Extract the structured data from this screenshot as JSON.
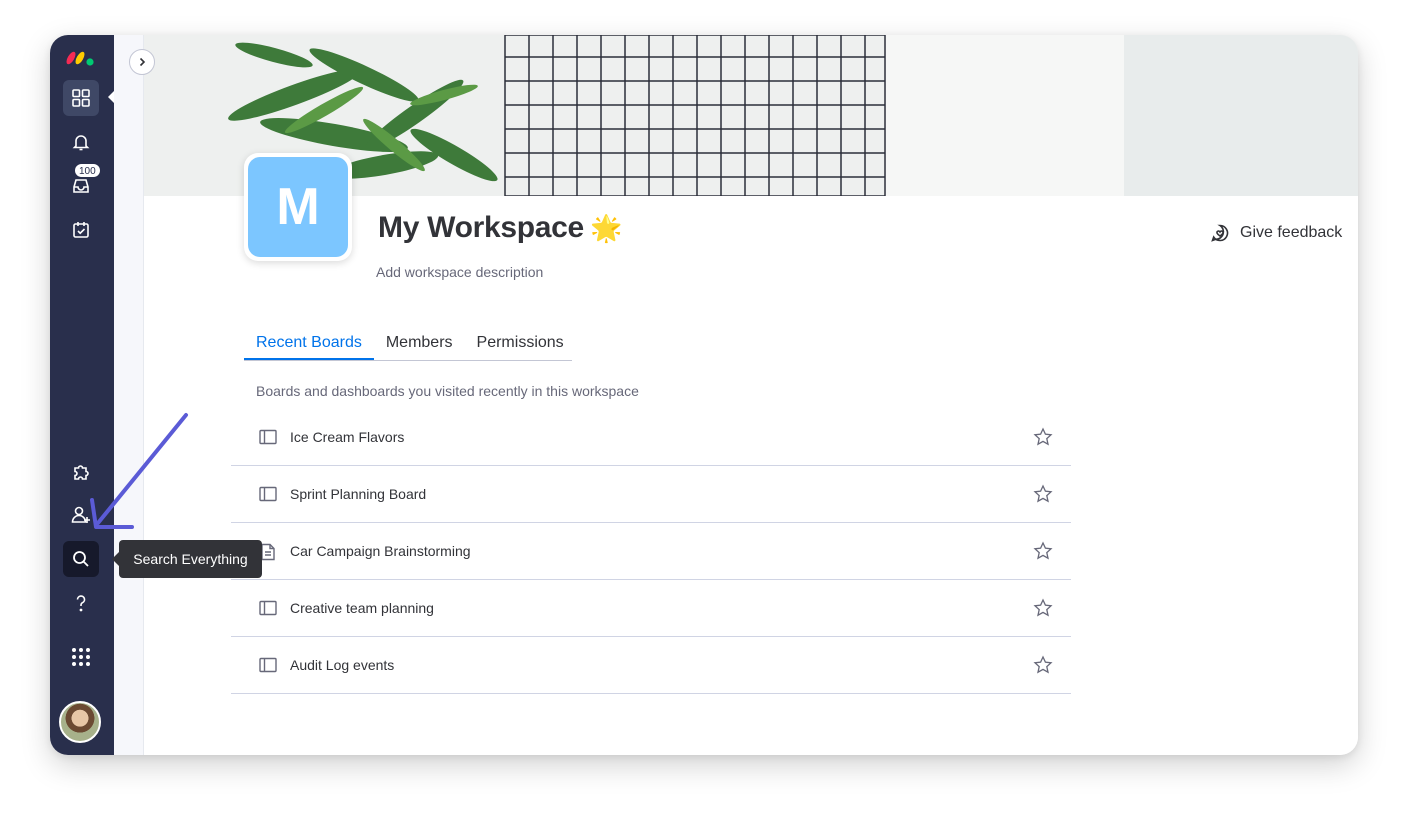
{
  "workspace": {
    "initial": "M",
    "title": "My Workspace",
    "emoji": "🌟",
    "description_placeholder": "Add workspace description",
    "feedback_label": "Give feedback"
  },
  "rail": {
    "inbox_badge": "100",
    "tooltip": "Search Everything",
    "icons": [
      "monday-logo",
      "home-grid-icon",
      "bell-icon",
      "inbox-icon",
      "my-work-icon",
      "puzzle-icon",
      "invite-user-icon",
      "search-icon",
      "help-icon",
      "apps-grid-icon",
      "user-avatar"
    ]
  },
  "tabs": [
    {
      "label": "Recent Boards",
      "active": true
    },
    {
      "label": "Members",
      "active": false
    },
    {
      "label": "Permissions",
      "active": false
    }
  ],
  "recent_note": "Boards and dashboards you visited recently in this workspace",
  "boards": [
    {
      "name": "Ice Cream Flavors",
      "icon": "board-icon"
    },
    {
      "name": "Sprint Planning Board",
      "icon": "board-icon"
    },
    {
      "name": "Car Campaign Brainstorming",
      "icon": "doc-icon"
    },
    {
      "name": "Creative team planning",
      "icon": "board-icon"
    },
    {
      "name": "Audit Log events",
      "icon": "board-icon"
    }
  ],
  "colors": {
    "rail_bg": "#292f4c",
    "accent": "#0073ea",
    "workspace_avatar": "#7cc6ff",
    "annotation_arrow": "#5b5bd6"
  }
}
